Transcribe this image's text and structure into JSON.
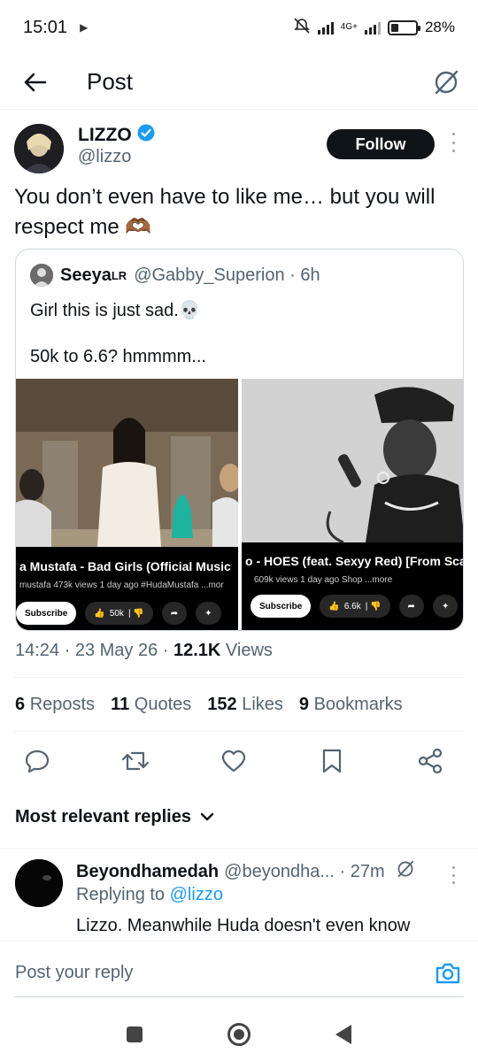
{
  "status_bar": {
    "time": "15:01",
    "network": "4G+",
    "battery": "28%"
  },
  "header": {
    "title": "Post"
  },
  "tweet": {
    "author_name": "LIZZO",
    "author_handle": "@lizzo",
    "follow_label": "Follow",
    "text": "You don’t even have to like me… but you will respect me 🫶🏾",
    "timestamp": "14:24 · 23 May 26 · ",
    "views_count": "12.1K",
    "views_label": " Views"
  },
  "quote": {
    "name": "Seeya",
    "name_sup": "LR",
    "handle": "@Gabby_Superion · 6h",
    "line1": "Girl this is just sad.💀",
    "line2": "50k to 6.6?    hmmmm...",
    "video_left": {
      "title": "a Mustafa - Bad Girls (Official Music",
      "meta": "mustafa  473k views  1 day ago  #HudaMustafa  ...mor",
      "subscribe": "Subscribe",
      "likes": "50k"
    },
    "video_right": {
      "title": "o - HOES (feat. Sexyy Red) [From Sca",
      "meta": "609k views  1 day ago  Shop  ...more",
      "subscribe": "Subscribe",
      "likes": "6.6k"
    }
  },
  "stats": {
    "reposts_count": "6",
    "reposts_label": "Reposts",
    "quotes_count": "11",
    "quotes_label": "Quotes",
    "likes_count": "152",
    "likes_label": "Likes",
    "bookmarks_count": "9",
    "bookmarks_label": "Bookmarks"
  },
  "actions": [
    "reply-icon",
    "repost-icon",
    "like-icon",
    "bookmark-icon",
    "share-icon"
  ],
  "replies_header": "Most relevant replies",
  "reply": {
    "name": "Beyondhamedah",
    "handle": "@beyondha... · 27m",
    "replying_prefix": "Replying to ",
    "replying_handle": "@lizzo",
    "text": "Lizzo. Meanwhile Huda doesn't even know"
  },
  "reply_bar": {
    "placeholder": "Post your reply"
  },
  "colors": {
    "accent": "#1d9bf0",
    "text": "#0f1419",
    "muted": "#536471",
    "border": "#cfd9de"
  }
}
